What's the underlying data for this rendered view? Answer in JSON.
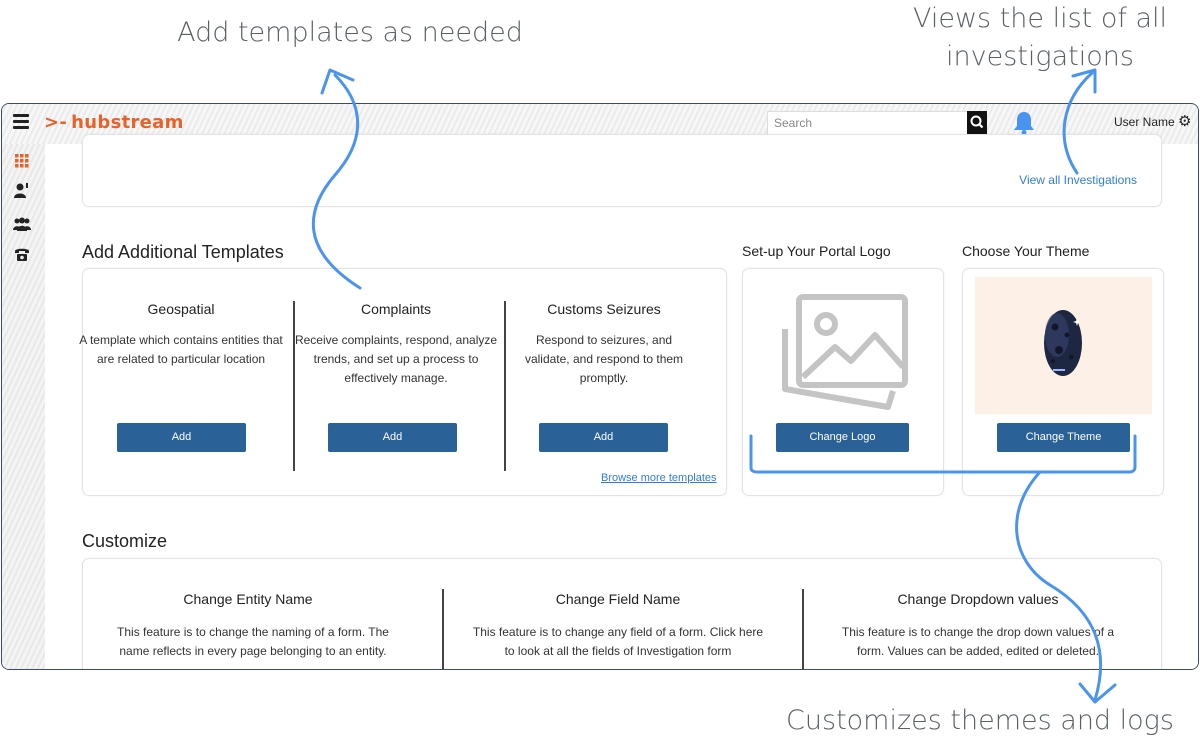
{
  "callouts": {
    "templates": "Add templates as needed",
    "investigations": "Views the list of all investigations",
    "themes": "Customizes themes and logs"
  },
  "topbar": {
    "brand": "hubstream",
    "search_placeholder": "Search",
    "user_name": "User Name"
  },
  "sidebar": {
    "icons": [
      "grid-icon",
      "user-icon",
      "team-icon",
      "phone-icon"
    ],
    "accent": "#e8622a"
  },
  "investigations": {
    "link": "View all Investigations"
  },
  "templates": {
    "heading": "Add Additional Templates",
    "items": [
      {
        "title": "Geospatial",
        "desc": "A template which contains entities that are related to particular location",
        "button": "Add"
      },
      {
        "title": "Complaints",
        "desc": "Receive complaints, respond, analyze trends, and set up a process to effectively manage.",
        "button": "Add"
      },
      {
        "title": "Customs Seizures",
        "desc": "Respond to seizures, and validate, and respond to them promptly.",
        "button": "Add"
      }
    ],
    "browse_link": "Browse more templates"
  },
  "portal_logo": {
    "heading": "Set-up Your Portal Logo",
    "button": "Change Logo"
  },
  "theme": {
    "heading": "Choose Your Theme",
    "button": "Change Theme",
    "preview_bg": "#fdf0e6"
  },
  "customize": {
    "heading": "Customize",
    "items": [
      {
        "title": "Change Entity Name",
        "desc": "This feature is to change the naming of a form. The name reflects in every page belonging to an entity."
      },
      {
        "title": "Change Field Name",
        "desc": "This feature is to change any field of a form. Click here to look at all the fields of Investigation form"
      },
      {
        "title": "Change Dropdown values",
        "desc": "This feature is to change the drop down values of a form. Values can be added, edited or deleted."
      }
    ]
  },
  "colors": {
    "button": "#2a6196",
    "link": "#2f7fd6",
    "arrow": "#4a94f0"
  }
}
